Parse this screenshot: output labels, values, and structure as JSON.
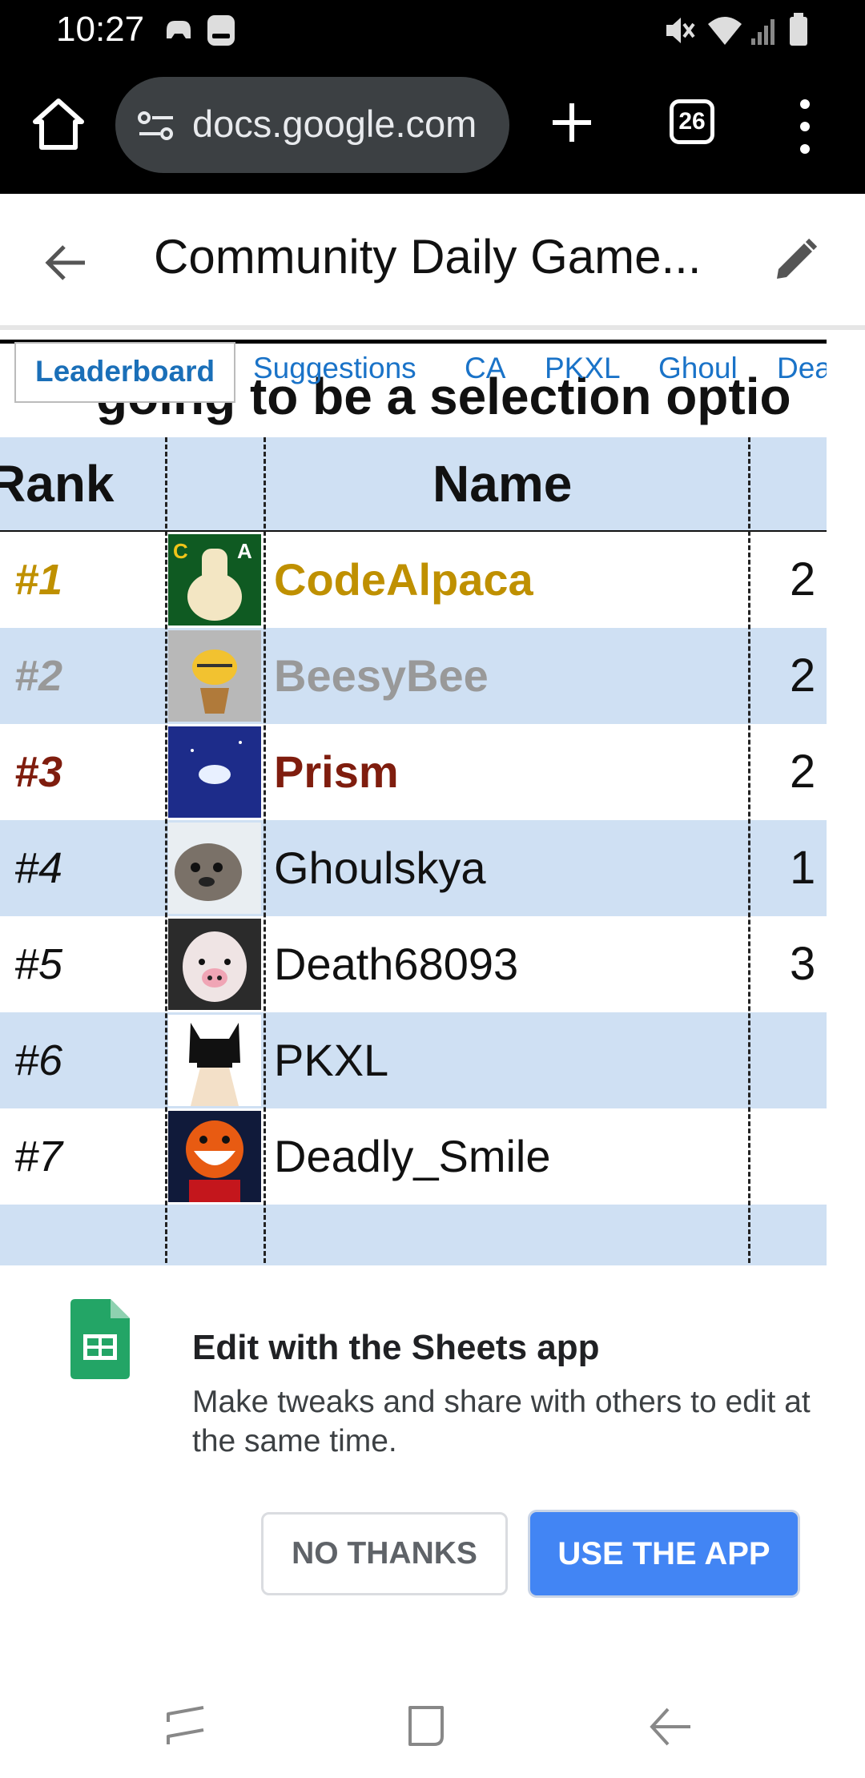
{
  "status_bar": {
    "time": "10:27"
  },
  "browser": {
    "url": "docs.google.com",
    "tab_count": "26"
  },
  "doc_header": {
    "title": "Community Daily Game..."
  },
  "sheet": {
    "headline_overflow": "going to be a selection optio",
    "tabs": [
      {
        "label": "Leaderboard",
        "active": true
      },
      {
        "label": "Suggestions"
      },
      {
        "label": "CA"
      },
      {
        "label": "PKXL"
      },
      {
        "label": "Ghoul"
      },
      {
        "label": "Death"
      }
    ],
    "columns": {
      "rank": "Rank",
      "name": "Name"
    },
    "rows": [
      {
        "rank": "#1",
        "name": "CodeAlpaca",
        "score": "2",
        "color": "#bf9000",
        "bold": true
      },
      {
        "rank": "#2",
        "name": "BeesyBee",
        "score": "2",
        "color": "#999999",
        "bold": true
      },
      {
        "rank": "#3",
        "name": "Prism",
        "score": "2",
        "color": "#7f1d0e",
        "bold": true
      },
      {
        "rank": "#4",
        "name": "Ghoulskya",
        "score": "1",
        "color": "#111111",
        "bold": false
      },
      {
        "rank": "#5",
        "name": "Death68093",
        "score": "3",
        "color": "#111111",
        "bold": false
      },
      {
        "rank": "#6",
        "name": "PKXL",
        "score": "",
        "color": "#111111",
        "bold": false
      },
      {
        "rank": "#7",
        "name": "Deadly_Smile",
        "score": "",
        "color": "#111111",
        "bold": false
      }
    ]
  },
  "app_prompt": {
    "title": "Edit with the Sheets app",
    "body": "Make tweaks and share with others to edit at the same time.",
    "no_thanks": "NO THANKS",
    "use_app": "USE THE APP"
  },
  "colors": {
    "sheets_green": "#23a566",
    "accent_blue": "#4285f4",
    "row_blue": "#cfe0f3"
  }
}
